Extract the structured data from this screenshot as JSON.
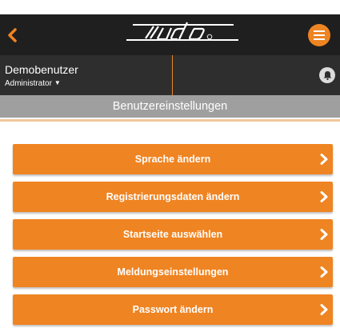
{
  "status_bar": {
    "time": ""
  },
  "app_bar": {
    "back_icon": "chevron-left-icon",
    "logo_text": "judo",
    "menu_icon": "hamburger-icon",
    "accent_color": "#ef8422"
  },
  "user": {
    "name": "Demobenutzer",
    "role": "Administrator",
    "bell_icon": "bell-icon"
  },
  "page": {
    "title": "Benutzereinstellungen"
  },
  "menu": {
    "items": [
      {
        "label": "Sprache ändern"
      },
      {
        "label": "Registrierungsdaten ändern"
      },
      {
        "label": "Startseite auswählen"
      },
      {
        "label": "Meldungseinstellungen"
      },
      {
        "label": "Passwort ändern"
      }
    ]
  }
}
